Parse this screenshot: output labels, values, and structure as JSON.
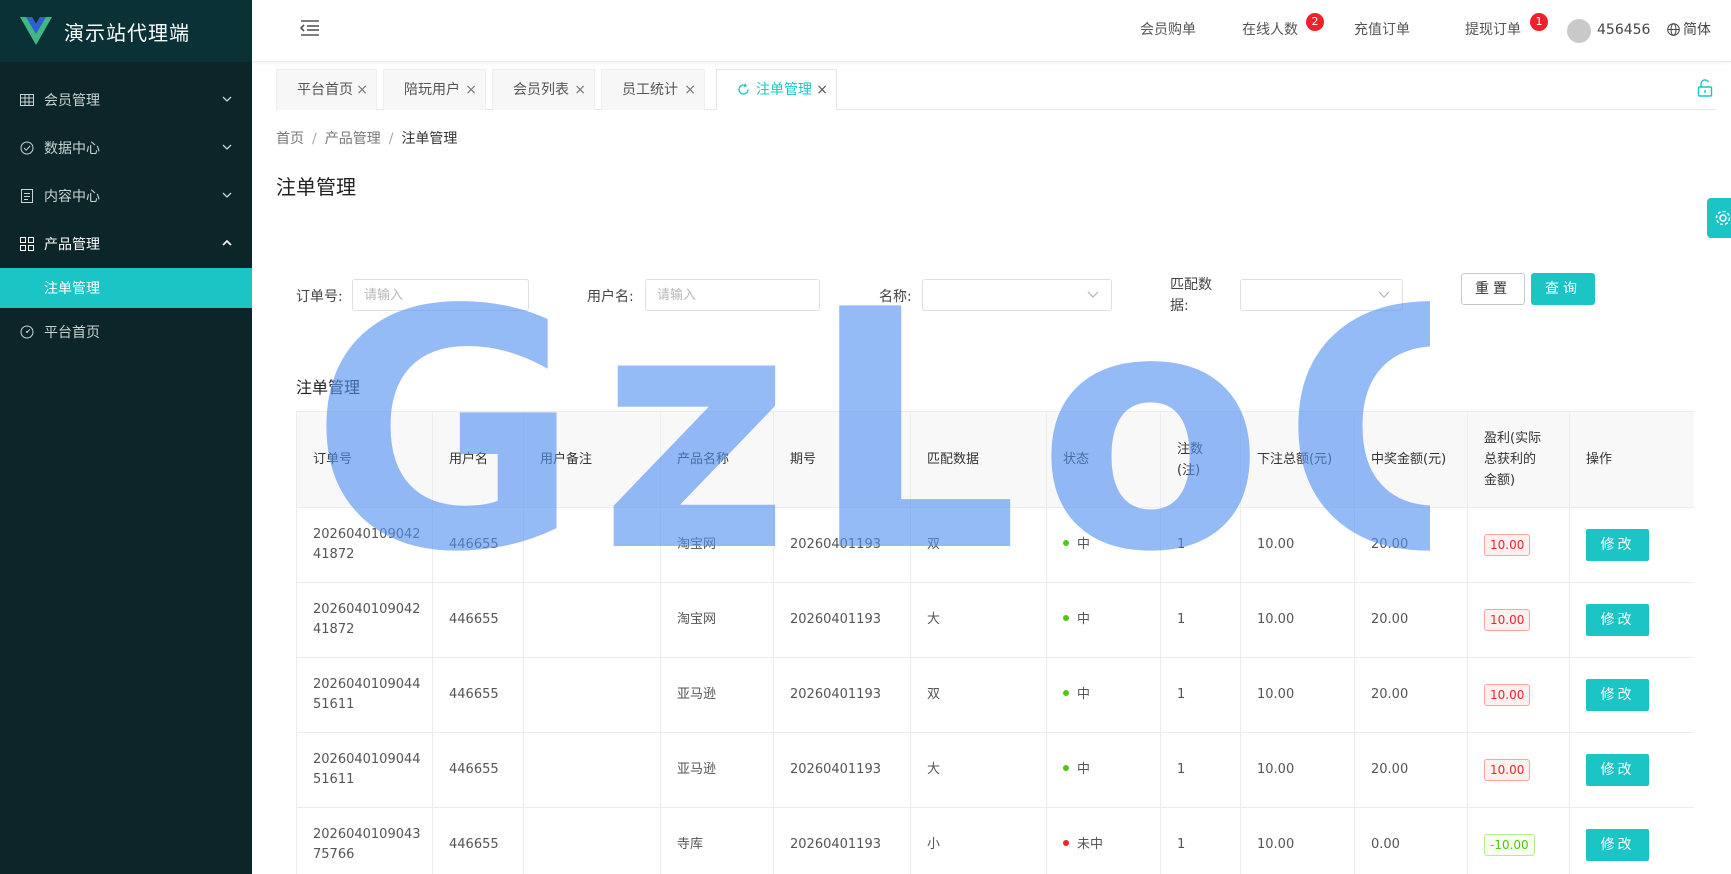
{
  "app": {
    "brand_name": "演示站代理端",
    "accent": "#1bc5c5",
    "sidebar_bg": "#0b2528"
  },
  "sidebar": {
    "items": [
      {
        "label": "会员管理",
        "icon": "grid-icon"
      },
      {
        "label": "数据中心",
        "icon": "check-circle-icon"
      },
      {
        "label": "内容中心",
        "icon": "document-icon"
      },
      {
        "label": "产品管理",
        "icon": "apps-icon",
        "expanded": true
      },
      {
        "label": "平台首页",
        "icon": "dashboard-icon"
      }
    ],
    "sub_item": "注单管理"
  },
  "header": {
    "nav": [
      "会员购单",
      "在线人数",
      "充值订单",
      "提现订单"
    ],
    "badges": {
      "online": "2",
      "withdraw": "1"
    },
    "username": "456456",
    "language": "简体"
  },
  "tabs": [
    "平台首页",
    "陪玩用户",
    "会员列表",
    "员工统计",
    "注单管理"
  ],
  "breadcrumb": [
    "首页",
    "产品管理",
    "注单管理"
  ],
  "page_title": "注单管理",
  "search": {
    "order_label": "订单号:",
    "order_placeholder": "请输入",
    "user_label": "用户名:",
    "user_placeholder": "请输入",
    "name_label": "名称:",
    "match_label_1": "匹配数",
    "match_label_2": "据:",
    "reset": "重置",
    "query": "查询"
  },
  "table": {
    "title": "注单管理",
    "columns": [
      [
        "订单号"
      ],
      [
        "用户名"
      ],
      [
        "用户备注"
      ],
      [
        "产品名称"
      ],
      [
        "期号"
      ],
      [
        "匹配数据"
      ],
      [
        "状态"
      ],
      [
        "注数",
        "(注)"
      ],
      [
        "下注总额(元)"
      ],
      [
        "中奖金额(元)"
      ],
      [
        "盈利(实际",
        "总获利的",
        "金额)"
      ],
      [
        "操作"
      ]
    ],
    "edit_label": "修改",
    "rows": [
      {
        "order": [
          "2026040109042",
          "41872"
        ],
        "user": "446655",
        "note": "",
        "product": "淘宝网",
        "period": "20260401193",
        "match": "双",
        "status": "中",
        "win": true,
        "count": "1",
        "bet": "10.00",
        "prize": "20.00",
        "profit": "10.00"
      },
      {
        "order": [
          "2026040109042",
          "41872"
        ],
        "user": "446655",
        "note": "",
        "product": "淘宝网",
        "period": "20260401193",
        "match": "大",
        "status": "中",
        "win": true,
        "count": "1",
        "bet": "10.00",
        "prize": "20.00",
        "profit": "10.00"
      },
      {
        "order": [
          "2026040109044",
          "51611"
        ],
        "user": "446655",
        "note": "",
        "product": "亚马逊",
        "period": "20260401193",
        "match": "双",
        "status": "中",
        "win": true,
        "count": "1",
        "bet": "10.00",
        "prize": "20.00",
        "profit": "10.00"
      },
      {
        "order": [
          "2026040109044",
          "51611"
        ],
        "user": "446655",
        "note": "",
        "product": "亚马逊",
        "period": "20260401193",
        "match": "大",
        "status": "中",
        "win": true,
        "count": "1",
        "bet": "10.00",
        "prize": "20.00",
        "profit": "10.00"
      },
      {
        "order": [
          "2026040109043",
          "75766"
        ],
        "user": "446655",
        "note": "",
        "product": "寺库",
        "period": "20260401193",
        "match": "小",
        "status": "未中",
        "win": false,
        "count": "1",
        "bet": "10.00",
        "prize": "0.00",
        "profit": "-10.00"
      }
    ]
  },
  "watermark": "GzLoG"
}
